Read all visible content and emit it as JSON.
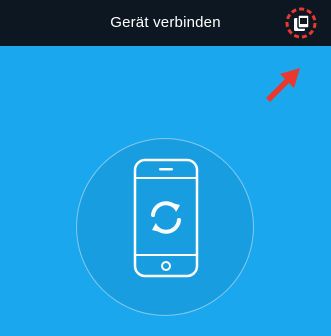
{
  "header": {
    "title": "Gerät verbinden",
    "connect_button_icon": "device-connect-icon"
  },
  "main": {
    "illustration_icon": "phone-sync-icon",
    "sync_icon": "sync-arrows-icon"
  },
  "colors": {
    "header_background": "#0d1722",
    "screen_background": "#1aa7ee",
    "annotation_red": "#e8392f",
    "icon_white": "#ffffff"
  }
}
